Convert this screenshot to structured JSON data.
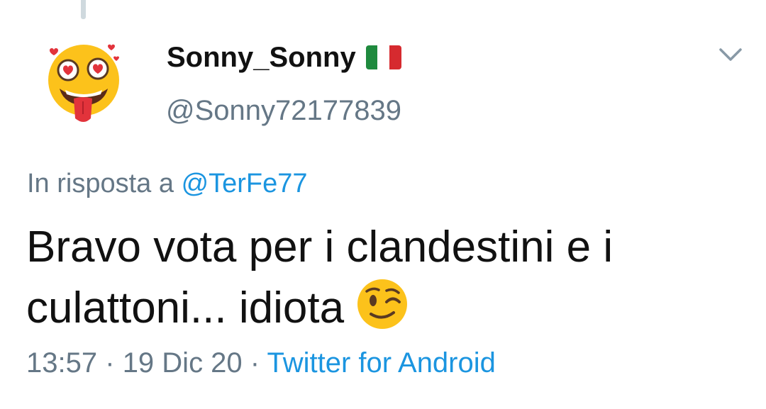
{
  "tweet": {
    "display_name": "Sonny_Sonny",
    "handle": "@Sonny72177839",
    "reply_prefix": "In risposta a",
    "reply_to": "@TerFe77",
    "text_line1": "Bravo vota per i clandestini e i",
    "text_line2": "culattoni... idiota",
    "time": "13:57",
    "separator": "·",
    "date": "19 Dic 20",
    "source": "Twitter for Android"
  },
  "icons": {
    "avatar": "heart-eyes-tongue-emoji-avatar",
    "flag": "italy-flag-icon",
    "menu": "chevron-down-icon",
    "emoji": "winking-face-emoji"
  },
  "colors": {
    "text": "#111111",
    "secondary": "#657786",
    "link": "#1b95e0",
    "emoji_yellow": "#fcc21b",
    "flag_green": "#1f8a3e",
    "flag_red": "#d62a2f"
  }
}
